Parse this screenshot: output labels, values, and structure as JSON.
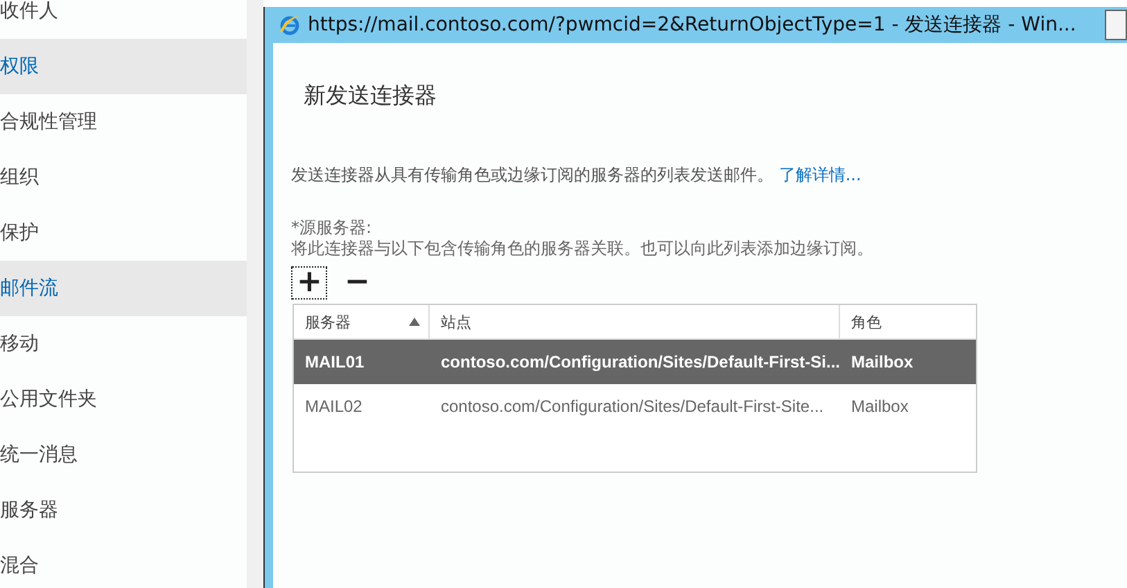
{
  "sidebar": {
    "items": [
      {
        "label": "收件人",
        "selected": false
      },
      {
        "label": "权限",
        "selected": true
      },
      {
        "label": "合规性管理",
        "selected": false
      },
      {
        "label": "组织",
        "selected": false
      },
      {
        "label": "保护",
        "selected": false
      },
      {
        "label": "邮件流",
        "selected": true
      },
      {
        "label": "移动",
        "selected": false
      },
      {
        "label": "公用文件夹",
        "selected": false
      },
      {
        "label": "统一消息",
        "selected": false
      },
      {
        "label": "服务器",
        "selected": false
      },
      {
        "label": "混合",
        "selected": false
      }
    ]
  },
  "dialog": {
    "window_title": "https://mail.contoso.com/?pwmcid=2&ReturnObjectType=1 - 发送连接器 - Win...",
    "heading": "新发送连接器",
    "description": "发送连接器从具有传输角色或边缘订阅的服务器的列表发送邮件。",
    "learn_more": "了解详情...",
    "field_label": "*源服务器:",
    "field_hint": "将此连接器与以下包含传输角色的服务器关联。也可以向此列表添加边缘订阅。",
    "add_button": "+",
    "remove_button": "−",
    "table": {
      "columns": [
        {
          "label": "服务器",
          "sorted": true
        },
        {
          "label": "站点",
          "sorted": false
        },
        {
          "label": "角色",
          "sorted": false
        }
      ],
      "rows": [
        {
          "cells": [
            "MAIL01",
            "contoso.com/Configuration/Sites/Default-First-Si...",
            "Mailbox"
          ],
          "selected": true
        },
        {
          "cells": [
            "MAIL02",
            "contoso.com/Configuration/Sites/Default-First-Site...",
            "Mailbox"
          ],
          "selected": false
        }
      ]
    }
  }
}
